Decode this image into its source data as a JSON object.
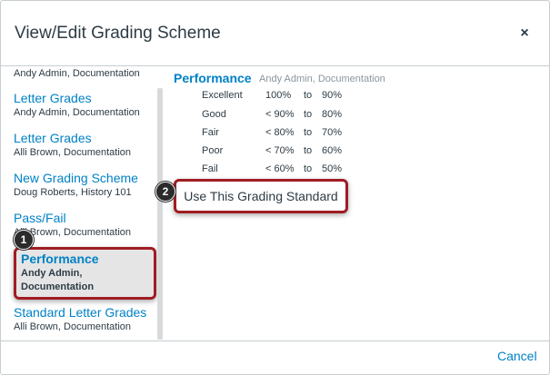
{
  "dialog": {
    "title": "View/Edit Grading Scheme",
    "close_label": "×",
    "cancel_label": "Cancel"
  },
  "schemes": [
    {
      "title": "",
      "subtitle": "Andy Admin, Documentation"
    },
    {
      "title": "Letter Grades",
      "subtitle": "Andy Admin, Documentation"
    },
    {
      "title": "Letter Grades",
      "subtitle": "Alli Brown, Documentation"
    },
    {
      "title": "New Grading Scheme",
      "subtitle": "Doug Roberts, History 101"
    },
    {
      "title": "Pass/Fail",
      "subtitle": "Alli Brown, Documentation"
    },
    {
      "title": "Performance",
      "subtitle_line1": "Andy Admin,",
      "subtitle_line2": "Documentation",
      "selected": true
    },
    {
      "title": "Standard Letter Grades",
      "subtitle": "Alli Brown, Documentation"
    }
  ],
  "detail": {
    "name": "Performance",
    "meta": "Andy Admin, Documentation",
    "rows": [
      {
        "name": "Excellent",
        "upper": "100%",
        "to": "to",
        "lower": "90%"
      },
      {
        "name": "Good",
        "upper": "< 90%",
        "to": "to",
        "lower": "80%"
      },
      {
        "name": "Fair",
        "upper": "< 80%",
        "to": "to",
        "lower": "70%"
      },
      {
        "name": "Poor",
        "upper": "< 70%",
        "to": "to",
        "lower": "60%"
      },
      {
        "name": "Fail",
        "upper": "< 60%",
        "to": "to",
        "lower": "50%"
      }
    ],
    "use_button_label": "Use This Grading Standard"
  },
  "callouts": {
    "one": "1",
    "two": "2"
  },
  "colors": {
    "link": "#0081c6",
    "highlight": "#a01c24",
    "selected_bg": "#e5e5e5"
  }
}
